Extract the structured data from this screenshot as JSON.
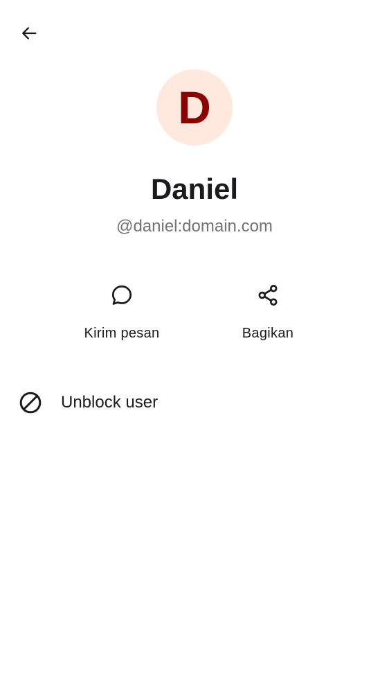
{
  "header": {
    "back_icon": "arrow-left-icon"
  },
  "profile": {
    "avatar_initial": "D",
    "avatar_bg_color": "#ffe8dd",
    "avatar_text_color": "#8b0000",
    "display_name": "Daniel",
    "user_id": "@daniel:domain.com"
  },
  "actions": [
    {
      "icon": "chat-bubble-icon",
      "label": "Kirim pesan"
    },
    {
      "icon": "share-icon",
      "label": "Bagikan"
    }
  ],
  "options": [
    {
      "icon": "block-icon",
      "label": "Unblock user"
    }
  ]
}
